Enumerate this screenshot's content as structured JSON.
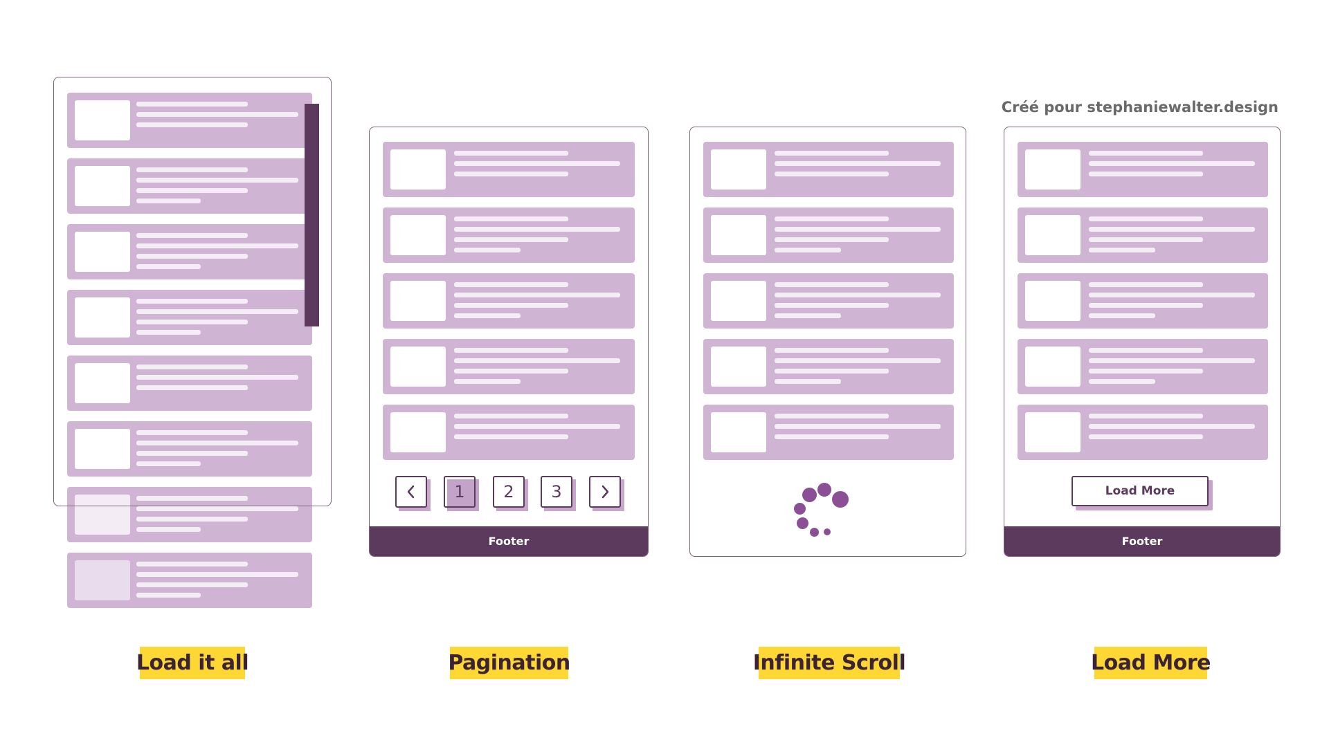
{
  "credit": "Créé pour stephaniewalter.design",
  "colors": {
    "card": "#cfb4d3",
    "accent_dark": "#5b3a5d",
    "spinner": "#8a4f95",
    "highlight": "#fdd835",
    "label_text": "#3b2234"
  },
  "panels": [
    {
      "id": "load-it-all",
      "label": "Load it all",
      "card_lines": [
        3,
        4,
        4,
        4,
        3,
        4,
        4,
        4
      ],
      "has_scrollbar": true
    },
    {
      "id": "pagination",
      "label": "Pagination",
      "card_lines": [
        3,
        4,
        4,
        4,
        3
      ],
      "pagination": {
        "prev_icon": "chevron-left-icon",
        "pages": [
          "1",
          "2",
          "3"
        ],
        "active_page": "1",
        "next_icon": "chevron-right-icon"
      },
      "footer": "Footer"
    },
    {
      "id": "infinite-scroll",
      "label": "Infinite Scroll",
      "card_lines": [
        3,
        4,
        4,
        4,
        3
      ],
      "loader_icon": "loading-spinner-icon"
    },
    {
      "id": "load-more",
      "label": "Load More",
      "card_lines": [
        3,
        4,
        4,
        4,
        3
      ],
      "button": "Load More",
      "footer": "Footer"
    }
  ]
}
